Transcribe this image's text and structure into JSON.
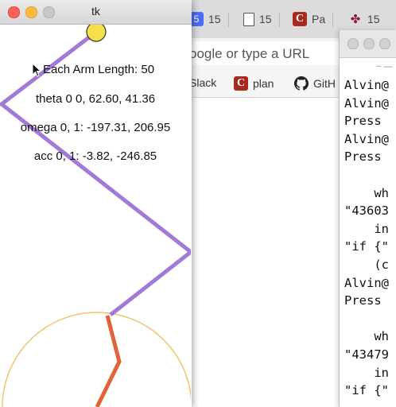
{
  "browser": {
    "tabs": [
      {
        "icon": "blue-square-icon",
        "title": "15"
      },
      {
        "icon": "document-icon",
        "title": "15"
      },
      {
        "icon": "c-logo-icon",
        "title": "Pa"
      },
      {
        "icon": "pinwheel-icon",
        "title": "15"
      }
    ],
    "address_placeholder": "oogle or type a URL",
    "bookmarks": [
      {
        "label": "Slack",
        "icon": ""
      },
      {
        "label": "plan",
        "icon": "c-logo-icon"
      },
      {
        "label": "GitH",
        "icon": "github-icon"
      }
    ]
  },
  "terminal": {
    "title_fragment": "~ —",
    "lines": [
      "Alvin@",
      "Alvin@",
      "Press",
      "Alvin@",
      "Press",
      "",
      "    wh",
      "\"43603",
      "    in",
      "\"if {\"",
      "    (c",
      "Alvin@",
      "Press",
      "",
      "    wh",
      "\"43479",
      "    in",
      "\"if {\""
    ]
  },
  "tk": {
    "title": "tk",
    "arm_length": "Each Arm Length: 50",
    "theta": "theta 0 0, 62.60, 41.36",
    "omega": "omega 0, 1: -197.31, 206.95",
    "acc": "acc 0, 1: -3.82, -246.85",
    "colors": {
      "arm": "#a07ad9",
      "lower_arm": "#e0643a",
      "bob": "#f5e04a",
      "arc": "#f2c36b"
    }
  }
}
